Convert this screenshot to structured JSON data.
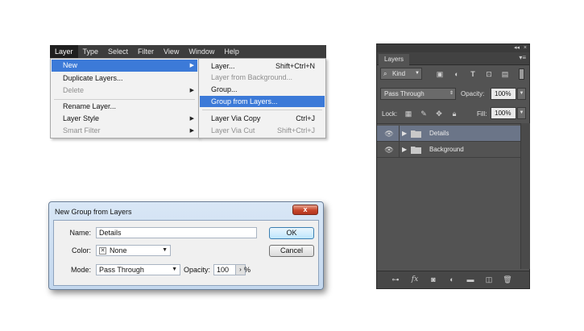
{
  "menubar": {
    "items": [
      "Layer",
      "Type",
      "Select",
      "Filter",
      "View",
      "Window",
      "Help"
    ]
  },
  "layer_menu": {
    "items": [
      {
        "label": "New"
      },
      {
        "label": "Duplicate Layers..."
      },
      {
        "label": "Delete"
      },
      {
        "label": "Rename Layer..."
      },
      {
        "label": "Layer Style"
      },
      {
        "label": "Smart Filter"
      }
    ],
    "submenu_arrow": "▶"
  },
  "new_submenu": {
    "items": [
      {
        "label": "Layer...",
        "shortcut": "Shift+Ctrl+N"
      },
      {
        "label": "Layer from Background..."
      },
      {
        "label": "Group..."
      },
      {
        "label": "Group from Layers..."
      },
      {
        "label": "Layer Via Copy",
        "shortcut": "Ctrl+J"
      },
      {
        "label": "Layer Via Cut",
        "shortcut": "Shift+Ctrl+J"
      }
    ]
  },
  "dialog": {
    "title": "New Group from Layers",
    "close_glyph": "x",
    "name_label": "Name:",
    "name_value": "Details",
    "color_label": "Color:",
    "color_value": "None",
    "color_swatch_glyph": "✕",
    "mode_label": "Mode:",
    "mode_value": "Pass Through",
    "opacity_label": "Opacity:",
    "opacity_value": "100",
    "opacity_unit": "%",
    "ok_label": "OK",
    "cancel_label": "Cancel",
    "stepper_glyph": "›"
  },
  "layers_panel": {
    "tab_label": "Layers",
    "collapse_glyph": "◂◂",
    "close_glyph": "×",
    "menu_glyph": "▾≡",
    "filter_value": "Kind",
    "filter_icon": "search-icon",
    "blend_mode": "Pass Through",
    "opacity_label": "Opacity:",
    "opacity_value": "100%",
    "lock_label": "Lock:",
    "fill_label": "Fill:",
    "fill_value": "100%",
    "layers": [
      {
        "name": "Details",
        "selected": true
      },
      {
        "name": "Background",
        "selected": false
      }
    ],
    "eye_glyph": "👁",
    "caret_glyph": "▶",
    "folder_color": "#c9c9c9",
    "selected_color": "#6b7588"
  }
}
